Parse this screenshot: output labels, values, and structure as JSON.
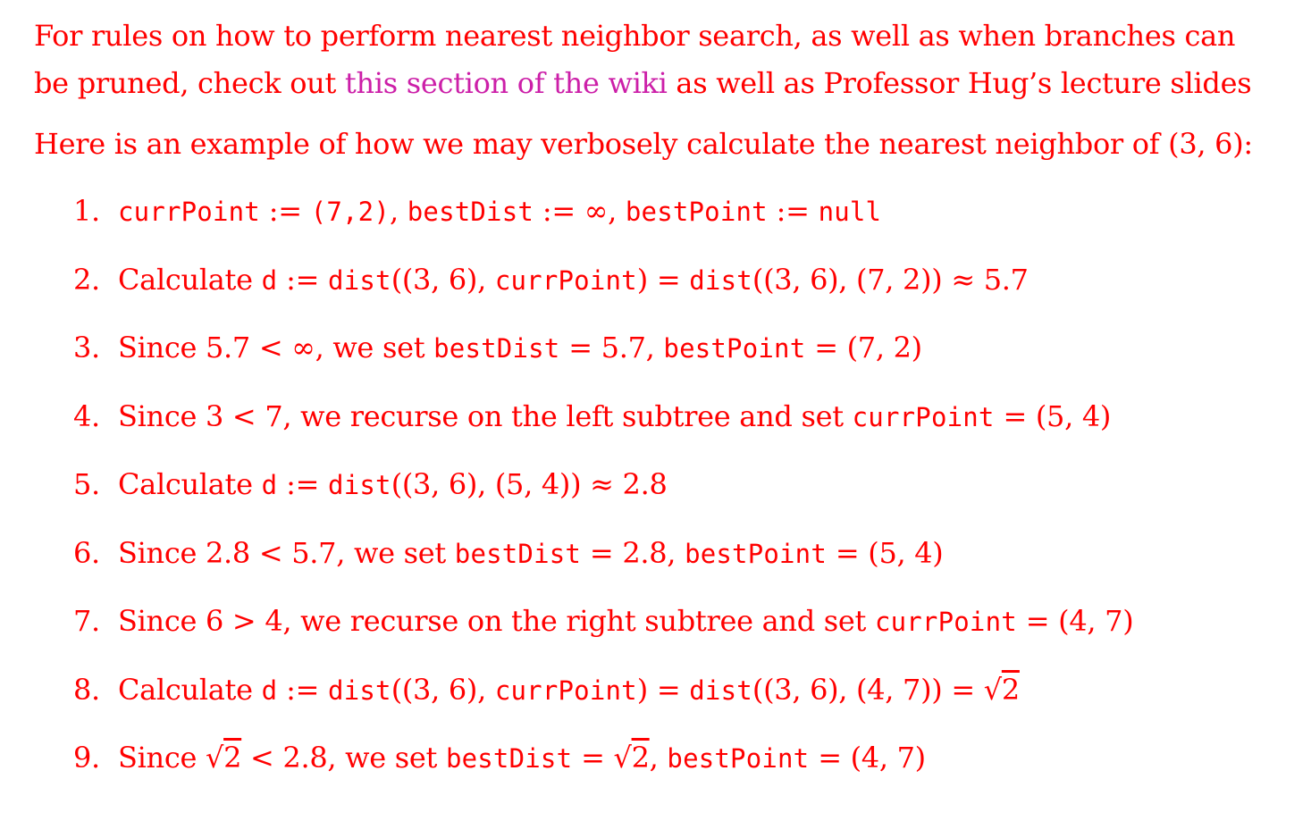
{
  "intro": {
    "line_part1": "For rules on how to perform nearest neighbor search, as well as when branches can be pruned, check out ",
    "link_text": "this section of the wiki",
    "line_part2": " as well as Professor Hug’s lecture slides"
  },
  "example_intro": "Here is an example of how we may verbosely calculate the nearest neighbor of (3, 6):",
  "steps": [
    {
      "num": "1.",
      "parts": [
        {
          "t": "code",
          "v": "currPoint"
        },
        {
          "t": "text",
          "v": " := "
        },
        {
          "t": "code",
          "v": "(7,2)"
        },
        {
          "t": "text",
          "v": ", "
        },
        {
          "t": "code",
          "v": "bestDist"
        },
        {
          "t": "text",
          "v": " := ∞, "
        },
        {
          "t": "code",
          "v": "bestPoint"
        },
        {
          "t": "text",
          "v": " := "
        },
        {
          "t": "code",
          "v": "null"
        }
      ]
    },
    {
      "num": "2.",
      "parts": [
        {
          "t": "text",
          "v": "Calculate "
        },
        {
          "t": "code",
          "v": "d"
        },
        {
          "t": "text",
          "v": " := "
        },
        {
          "t": "code",
          "v": "dist"
        },
        {
          "t": "text",
          "v": "((3, 6), "
        },
        {
          "t": "code",
          "v": "currPoint"
        },
        {
          "t": "text",
          "v": ") = "
        },
        {
          "t": "code",
          "v": "dist"
        },
        {
          "t": "text",
          "v": "((3, 6), (7, 2)) ≈ 5.7"
        }
      ]
    },
    {
      "num": "3.",
      "parts": [
        {
          "t": "text",
          "v": "Since 5.7 < ∞, we set "
        },
        {
          "t": "code",
          "v": "bestDist"
        },
        {
          "t": "text",
          "v": " = 5.7, "
        },
        {
          "t": "code",
          "v": "bestPoint"
        },
        {
          "t": "text",
          "v": " = (7, 2)"
        }
      ]
    },
    {
      "num": "4.",
      "parts": [
        {
          "t": "text",
          "v": "Since 3 < 7, we recurse on the left subtree and set "
        },
        {
          "t": "code",
          "v": "currPoint"
        },
        {
          "t": "text",
          "v": " = (5, 4)"
        }
      ]
    },
    {
      "num": "5.",
      "parts": [
        {
          "t": "text",
          "v": "Calculate "
        },
        {
          "t": "code",
          "v": "d"
        },
        {
          "t": "text",
          "v": " := "
        },
        {
          "t": "code",
          "v": "dist"
        },
        {
          "t": "text",
          "v": "((3, 6), (5, 4)) ≈ 2.8"
        }
      ]
    },
    {
      "num": "6.",
      "parts": [
        {
          "t": "text",
          "v": "Since 2.8 < 5.7, we set "
        },
        {
          "t": "code",
          "v": "bestDist"
        },
        {
          "t": "text",
          "v": " = 2.8, "
        },
        {
          "t": "code",
          "v": "bestPoint"
        },
        {
          "t": "text",
          "v": " = (5, 4)"
        }
      ]
    },
    {
      "num": "7.",
      "parts": [
        {
          "t": "text",
          "v": "Since 6 > 4, we recurse on the right subtree and set "
        },
        {
          "t": "code",
          "v": "currPoint"
        },
        {
          "t": "text",
          "v": " = (4, 7)"
        }
      ]
    },
    {
      "num": "8.",
      "parts": [
        {
          "t": "text",
          "v": "Calculate "
        },
        {
          "t": "code",
          "v": "d"
        },
        {
          "t": "text",
          "v": " := "
        },
        {
          "t": "code",
          "v": "dist"
        },
        {
          "t": "text",
          "v": "((3, 6), "
        },
        {
          "t": "code",
          "v": "currPoint"
        },
        {
          "t": "text",
          "v": ") = "
        },
        {
          "t": "code",
          "v": "dist"
        },
        {
          "t": "text",
          "v": "((3, 6), (4, 7)) = "
        },
        {
          "t": "sqrt",
          "v": "2"
        }
      ]
    },
    {
      "num": "9.",
      "parts": [
        {
          "t": "text",
          "v": "Since "
        },
        {
          "t": "sqrt",
          "v": "2"
        },
        {
          "t": "text",
          "v": " < 2.8, we set "
        },
        {
          "t": "code",
          "v": "bestDist"
        },
        {
          "t": "text",
          "v": " = "
        },
        {
          "t": "sqrt",
          "v": "2"
        },
        {
          "t": "text",
          "v": ", "
        },
        {
          "t": "code",
          "v": "bestPoint"
        },
        {
          "t": "text",
          "v": " = (4, 7)"
        }
      ]
    }
  ],
  "colors": {
    "text": "#ff0000",
    "link": "#cc1fa8",
    "background": "#ffffff"
  }
}
